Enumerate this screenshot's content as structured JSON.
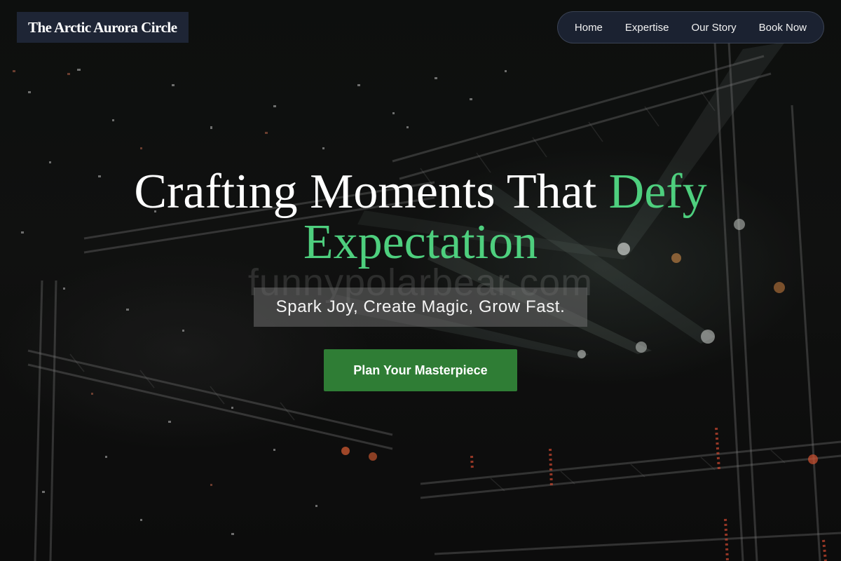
{
  "brand": {
    "name": "The Arctic Aurora Circle"
  },
  "nav": {
    "items": [
      {
        "label": "Home"
      },
      {
        "label": "Expertise"
      },
      {
        "label": "Our Story"
      },
      {
        "label": "Book Now"
      }
    ]
  },
  "hero": {
    "headline_part1": "Crafting Moments That ",
    "headline_accent": "Defy Expectation",
    "tagline": "Spark Joy, Create Magic, Grow Fast.",
    "cta_label": "Plan Your Masterpiece",
    "watermark": "funnypolarbear.com"
  },
  "colors": {
    "accent_green": "#4ecf7e",
    "cta_green": "#2f7d35",
    "brand_bg": "#1e2535",
    "nav_bg": "#1c2434"
  }
}
